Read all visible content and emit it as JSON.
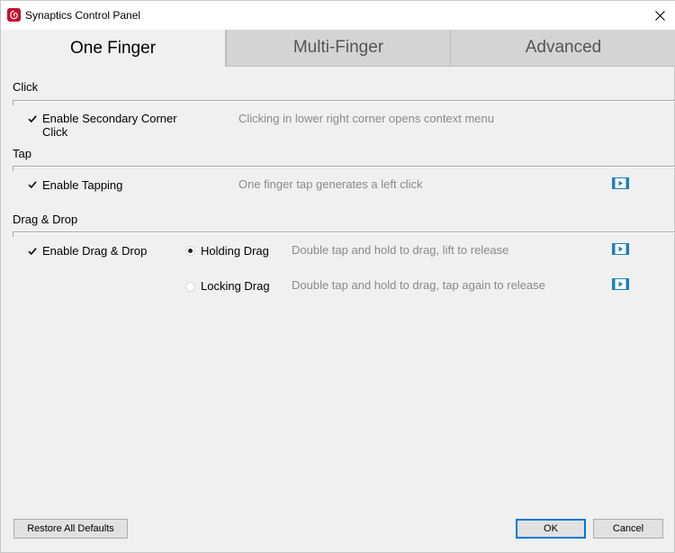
{
  "window": {
    "title": "Synaptics Control Panel",
    "icons": {
      "app": "synaptics-logo-icon",
      "close": "close-icon"
    }
  },
  "tabs": [
    {
      "label": "One Finger",
      "active": true
    },
    {
      "label": "Multi-Finger",
      "active": false
    },
    {
      "label": "Advanced",
      "active": false
    }
  ],
  "sections": {
    "click": {
      "label": "Click",
      "option": {
        "label": "Enable Secondary Corner Click",
        "checked": true,
        "description": "Clicking in lower right corner opens context menu"
      }
    },
    "tap": {
      "label": "Tap",
      "option": {
        "label": "Enable Tapping",
        "checked": true,
        "description": "One finger tap generates a left click",
        "video_icon": "video-play-icon"
      }
    },
    "drag_drop": {
      "label": "Drag & Drop",
      "option": {
        "label": "Enable Drag & Drop",
        "checked": true
      },
      "modes": [
        {
          "label": "Holding Drag",
          "selected": true,
          "description": "Double tap and hold to drag, lift to release",
          "video_icon": "video-play-icon"
        },
        {
          "label": "Locking Drag",
          "selected": false,
          "description": "Double tap and hold to drag, tap again to release",
          "video_icon": "video-play-icon"
        }
      ]
    }
  },
  "buttons": {
    "restore": "Restore All Defaults",
    "ok": "OK",
    "cancel": "Cancel"
  },
  "colors": {
    "accent": "#0078d7",
    "video_icon": "#1e7fc0",
    "app_icon": "#c8102e"
  }
}
